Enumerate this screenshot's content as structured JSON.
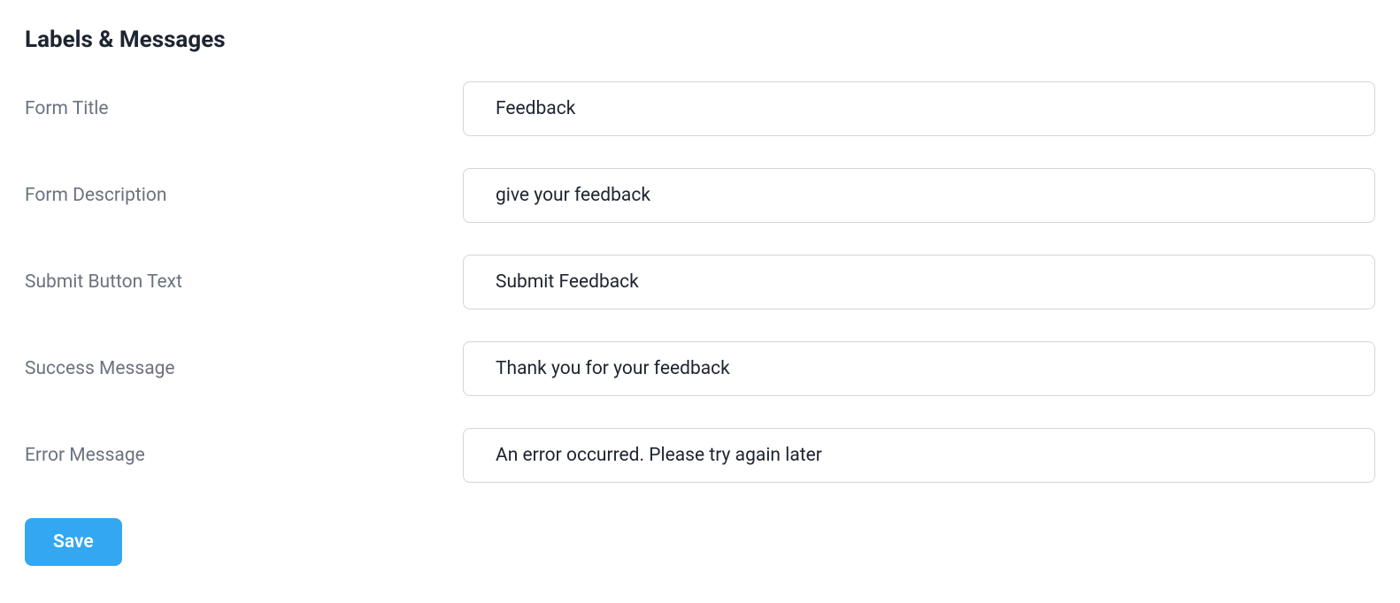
{
  "section": {
    "heading": "Labels & Messages"
  },
  "fields": {
    "formTitle": {
      "label": "Form Title",
      "value": "Feedback"
    },
    "formDescription": {
      "label": "Form Description",
      "value": "give your feedback"
    },
    "submitButtonText": {
      "label": "Submit Button Text",
      "value": "Submit Feedback"
    },
    "successMessage": {
      "label": "Success Message",
      "value": "Thank you for your feedback"
    },
    "errorMessage": {
      "label": "Error Message",
      "value": "An error occurred. Please try again later"
    }
  },
  "actions": {
    "save": "Save"
  }
}
